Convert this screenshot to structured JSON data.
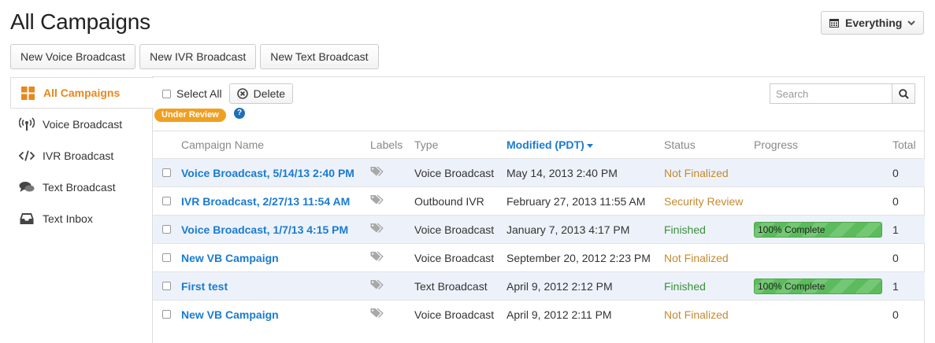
{
  "page": {
    "title": "All Campaigns"
  },
  "filter": {
    "label": "Everything"
  },
  "new_buttons": [
    "New Voice Broadcast",
    "New IVR Broadcast",
    "New Text Broadcast"
  ],
  "sidebar": {
    "items": [
      {
        "label": "All Campaigns",
        "icon": "grid-icon",
        "active": true
      },
      {
        "label": "Voice Broadcast",
        "icon": "broadcast-icon"
      },
      {
        "label": "IVR Broadcast",
        "icon": "code-icon"
      },
      {
        "label": "Text Broadcast",
        "icon": "chat-icon"
      },
      {
        "label": "Text Inbox",
        "icon": "inbox-icon"
      }
    ]
  },
  "toolbar": {
    "select_all": "Select All",
    "delete": "Delete"
  },
  "badge": {
    "label": "Under Review"
  },
  "help": {
    "label": "?"
  },
  "search": {
    "placeholder": "Search"
  },
  "table": {
    "columns": [
      "Campaign Name",
      "Labels",
      "Type",
      "Modified (PDT)",
      "Status",
      "Progress",
      "Total"
    ],
    "rows": [
      {
        "name": "Voice Broadcast, 5/14/13 2:40 PM",
        "type": "Voice Broadcast",
        "modified": "May 14, 2013 2:40 PM",
        "status": "Not Finalized",
        "progress": "",
        "total": "0"
      },
      {
        "name": "IVR Broadcast, 2/27/13 11:54 AM",
        "type": "Outbound IVR",
        "modified": "February 27, 2013 11:55 AM",
        "status": "Security Review",
        "progress": "",
        "total": "0"
      },
      {
        "name": "Voice Broadcast, 1/7/13 4:15 PM",
        "type": "Voice Broadcast",
        "modified": "January 7, 2013 4:17 PM",
        "status": "Finished",
        "progress": "100% Complete",
        "total": "1"
      },
      {
        "name": "New VB Campaign",
        "type": "Voice Broadcast",
        "modified": "September 20, 2012 2:23 PM",
        "status": "Not Finalized",
        "progress": "",
        "total": "0"
      },
      {
        "name": "First test",
        "type": "Text Broadcast",
        "modified": "April 9, 2012 2:12 PM",
        "status": "Finished",
        "progress": "100% Complete",
        "total": "1"
      },
      {
        "name": "New VB Campaign",
        "type": "Voice Broadcast",
        "modified": "April 9, 2012 2:11 PM",
        "status": "Not Finalized",
        "progress": "",
        "total": "0"
      }
    ]
  },
  "colors": {
    "accent": "#e8871e",
    "link": "#1a7bd1",
    "success": "#3a8f3a",
    "warning": "#c68a2e",
    "row_alt": "#edf2fa"
  }
}
